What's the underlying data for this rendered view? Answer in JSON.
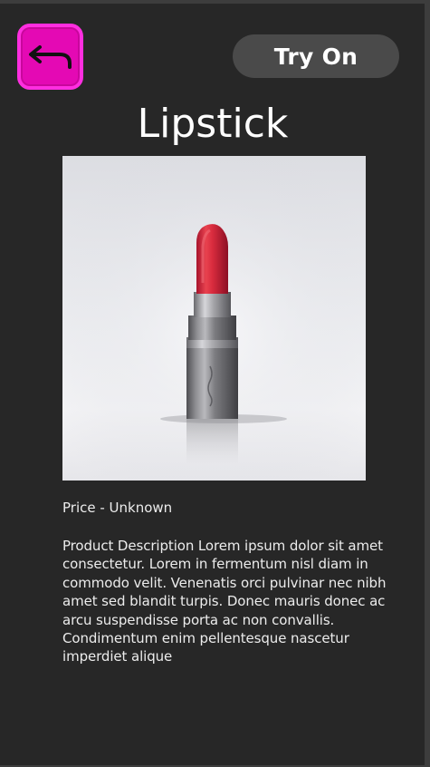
{
  "header": {
    "back_icon": "return-arrow-icon",
    "back_button_color": "#e409b4",
    "try_on_label": "Try On"
  },
  "product": {
    "title": "Lipstick",
    "image_icon": "lipstick-photo",
    "price_text": "Price - Unknown",
    "description": "Product Description Lorem ipsum dolor sit amet consectetur. Lorem in fermentum nisl diam in commodo velit. Venenatis orci pulvinar nec nibh amet sed blandit turpis. Donec mauris donec ac arcu suspendisse porta ac non convallis. Condimentum enim pellentesque nascetur imperdiet alique"
  },
  "colors": {
    "background": "#272727",
    "accent": "#e409b4",
    "button_bg": "#4a4a4a",
    "text": "#ffffff"
  }
}
